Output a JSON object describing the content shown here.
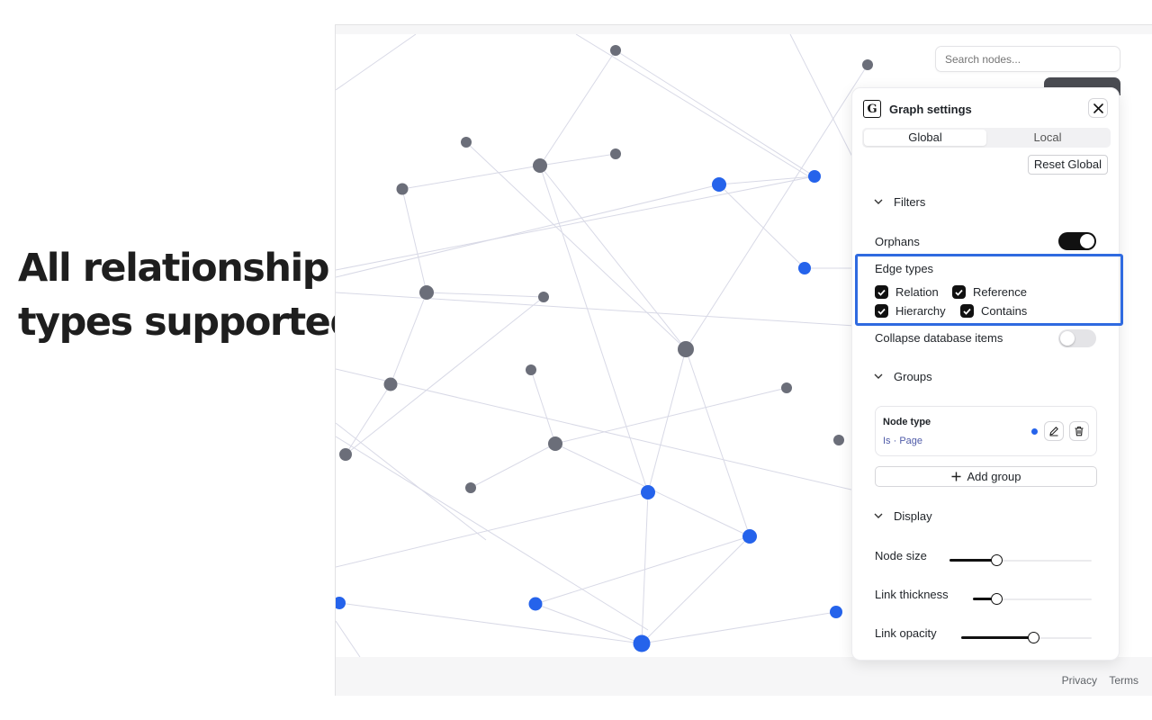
{
  "headline": {
    "line1": "All relationship",
    "line2": "types supported"
  },
  "search": {
    "placeholder": "Search nodes..."
  },
  "footer": {
    "privacy": "Privacy",
    "terms": "Terms"
  },
  "colors": {
    "node_gray": "#6b6e79",
    "node_blue": "#2563eb",
    "edge": "#d8d9e6",
    "highlight": "#2f6ae0"
  },
  "panel": {
    "logo_letter": "G",
    "title": "Graph settings",
    "tabs": [
      {
        "label": "Global",
        "active": true
      },
      {
        "label": "Local",
        "active": false
      }
    ],
    "reset_label": "Reset Global",
    "filters": {
      "heading": "Filters",
      "orphans_label": "Orphans",
      "orphans_on": true,
      "edge_types_label": "Edge types",
      "edge_types": [
        {
          "label": "Relation",
          "checked": true
        },
        {
          "label": "Reference",
          "checked": true
        },
        {
          "label": "Hierarchy",
          "checked": true
        },
        {
          "label": "Contains",
          "checked": true
        }
      ],
      "collapse_label": "Collapse database items",
      "collapse_on": false
    },
    "groups": {
      "heading": "Groups",
      "items": [
        {
          "title": "Node type",
          "subtitle": "Is · Page",
          "color": "#2563eb"
        }
      ],
      "add_label": "Add group"
    },
    "display": {
      "heading": "Display",
      "node_size_label": "Node size",
      "node_size_value": 0.33,
      "link_thickness_label": "Link thickness",
      "link_thickness_value": 0.2,
      "link_opacity_label": "Link opacity",
      "link_opacity_value": 0.55
    }
  }
}
